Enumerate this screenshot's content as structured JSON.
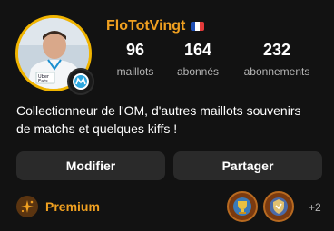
{
  "profile": {
    "username": "FloTotVingt",
    "bio": "Collectionneur de l'OM, d'autres maillots souvenirs de matchs et quelques kiffs !"
  },
  "stats": [
    {
      "value": "96",
      "label": "maillots"
    },
    {
      "value": "164",
      "label": "abonnés"
    },
    {
      "value": "232",
      "label": "abonnements"
    }
  ],
  "actions": {
    "edit_label": "Modifier",
    "share_label": "Partager"
  },
  "premium": {
    "label": "Premium"
  },
  "badges": {
    "extra_count": "+2"
  },
  "colors": {
    "accent": "#f0a020",
    "background": "#121212",
    "button": "#2a2a2a",
    "muted_text": "#b5b5b5"
  },
  "icons": {
    "avatar_badge": "om-club-crest-icon",
    "flag": "france-flag-icon",
    "premium": "sparkle-icon"
  }
}
